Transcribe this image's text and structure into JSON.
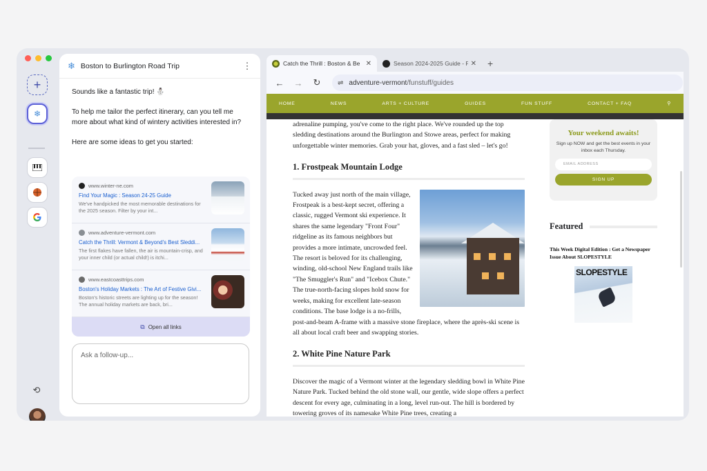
{
  "window": {
    "lights": [
      "#ff5f57",
      "#febc2e",
      "#28c840"
    ]
  },
  "rail": {
    "new_icon": "+",
    "active_icon": "❄",
    "items": [
      "piano-icon",
      "basketball-icon",
      "google-g-icon"
    ],
    "history_icon": "⟲"
  },
  "chat": {
    "title": "Boston to Burlington Road Trip",
    "menu_icon": "⋮",
    "messages": [
      "Sounds like a fantastic trip! ⛄",
      "To help me tailor the perfect itinerary, can you tell me more about what kind of wintery activities interested in?",
      "Here are some ideas to get you started:"
    ],
    "links": [
      {
        "source": "www.winter-ne.com",
        "title": "Find Your Magic : Season 24-25 Guide",
        "desc": "We've handpicked the most memorable destinations for the 2025 season. Filter by your int...",
        "favicon": "#222222"
      },
      {
        "source": "www.adventure-vermont.com",
        "title": "Catch the Thrill: Vermont & Beyond's Best Sleddi...",
        "desc": "The first flakes have fallen, the air is mountain-crisp, and your inner child (or actual child!) is itchi...",
        "favicon": "#8a8f94"
      },
      {
        "source": "www.eastcoasttrips.com",
        "title": "Boston's Holiday Markets : The Art of Festive Givi...",
        "desc": "Boston's historic streets are lighting up for the season! The annual holiday markets are back, bri...",
        "favicon": "#6b6b6b"
      }
    ],
    "open_all": "Open all links",
    "followup_placeholder": "Ask a follow-up..."
  },
  "browser": {
    "tabs": [
      {
        "title": "Catch the Thrill : Boston & Be",
        "active": true
      },
      {
        "title": "Season 2024-2025 Guide - F",
        "active": false
      }
    ],
    "new_tab": "+",
    "url_domain": "adventure-vermont",
    "url_path": "/funstuff/guides"
  },
  "site": {
    "nav": [
      "HOME",
      "NEWS",
      "ARTS + CULTURE",
      "GUIDES",
      "FUN STUFF",
      "CONTACT + FAQ"
    ],
    "nav_color": "#9aa52c",
    "intro": "adrenaline pumping, you've come to the right place. We've rounded up the top sledding destinations around the Burlington and Stowe areas, perfect for making unforgettable winter memories. Grab your hat, gloves, and a fast sled – let's go!",
    "sections": [
      {
        "heading": "1. Frostpeak Mountain Lodge",
        "body": "Tucked away just north of the main village, Frostpeak is a best-kept secret, offering a classic, rugged Vermont ski experience. It shares the same legendary \"Front Four\" ridgeline as its famous neighbors but provides a more intimate, uncrowded feel. The resort is beloved for its challenging, winding, old-school New England trails like \"The Smuggler's Run\" and \"Icebox Chute.\" The true-north-facing slopes hold snow for weeks, making for excellent late-season conditions. The base lodge is a no-frills, post-and-beam A-frame with a massive stone fireplace, where the après-ski scene is all about local craft beer and swapping stories."
      },
      {
        "heading": "2. White Pine Nature Park",
        "body": "Discover the magic of a Vermont winter at the legendary sledding bowl in White Pine Nature Park. Tucked behind the old stone wall, our gentle, wide slope offers a perfect descent for every age, culminating in a long, level run-out. The hill is bordered by towering groves of its namesake White Pine trees, creating a"
      }
    ],
    "signup": {
      "title": "Your weekend awaits!",
      "text": "Sign up NOW and get the best events in your inbox each Thursday.",
      "placeholder": "EMAIL ADDRESS",
      "button": "SIGN UP"
    },
    "featured": {
      "title": "Featured",
      "text": "This Week Digital Edition : Get a Newspaper Issue About SLOPESTYLE",
      "mag_title": "SLOPESTYLE"
    }
  }
}
